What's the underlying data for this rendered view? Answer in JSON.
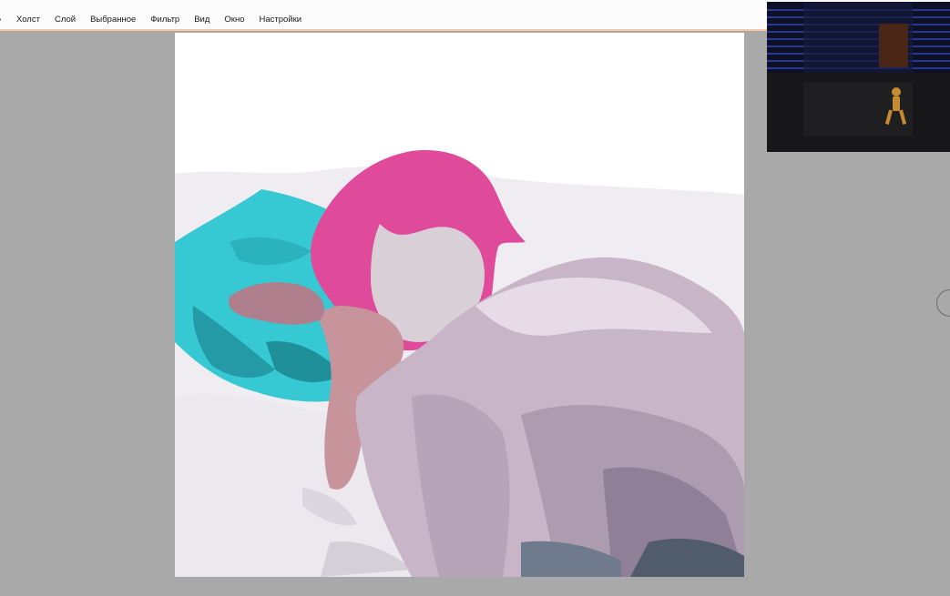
{
  "menubar": {
    "edge_item": "ь",
    "items": [
      {
        "id": "canvas",
        "label": "Холст"
      },
      {
        "id": "layer",
        "label": "Слой"
      },
      {
        "id": "favorites",
        "label": "Выбранное"
      },
      {
        "id": "filter",
        "label": "Фильтр"
      },
      {
        "id": "view",
        "label": "Вид"
      },
      {
        "id": "window",
        "label": "Окно"
      },
      {
        "id": "settings",
        "label": "Настройки"
      }
    ]
  },
  "colors": {
    "workspace": "#a9a9a9",
    "menubar": "#fbfbfb",
    "menubar_accent": "#f4c9a8",
    "canvas": "#ffffff",
    "hair": "#e04a9b",
    "pillow": "#36c9d3",
    "shirt": "#c9b5c8",
    "skin": "#c8949c"
  },
  "canvas": {
    "content": "artwork-in-progress"
  },
  "video_overlay": {
    "content": "dark-room-scene"
  }
}
